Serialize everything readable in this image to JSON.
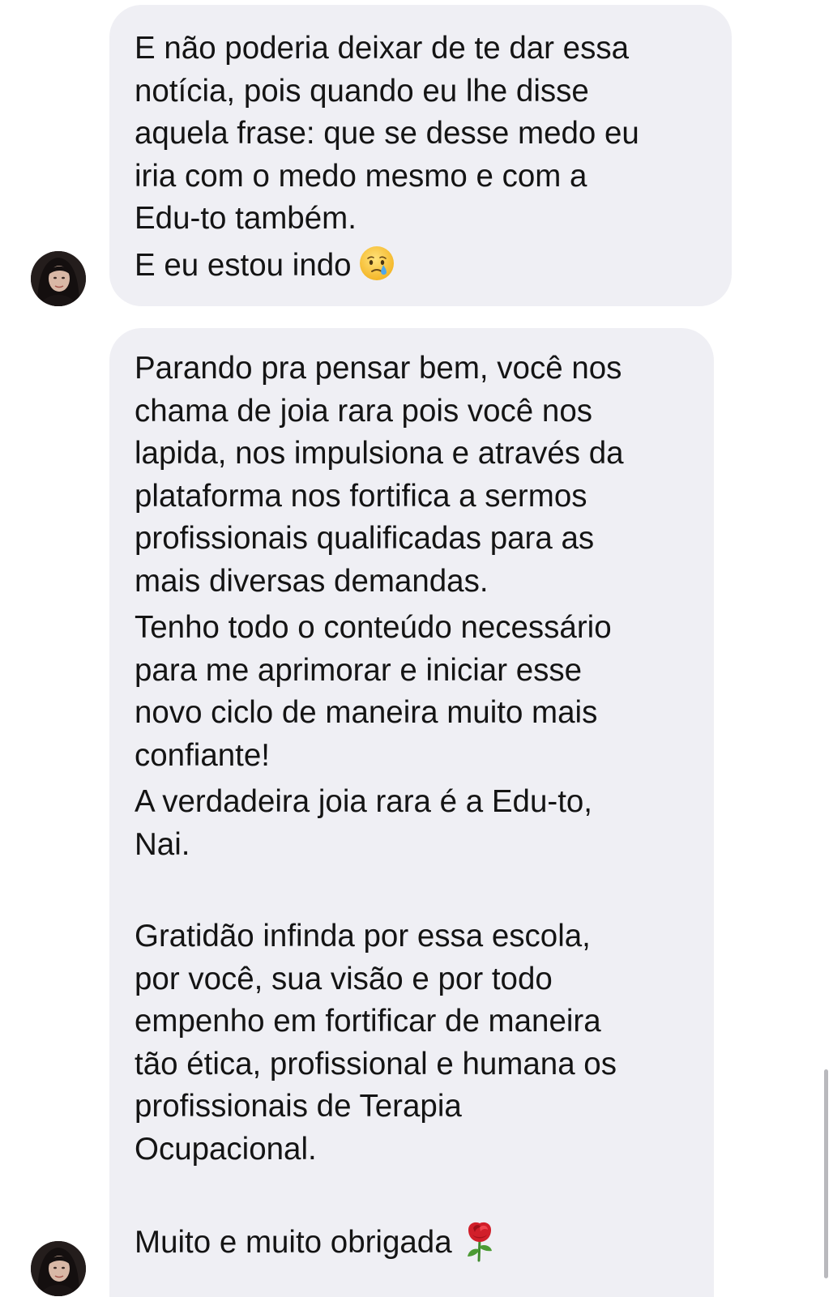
{
  "messages": [
    {
      "lines": [
        "E não poderia deixar de te dar essa",
        "notícia, pois quando eu lhe disse",
        "aquela frase: que se desse medo eu",
        "iria com o medo mesmo e com a",
        "Edu-to também.",
        "E eu estou indo"
      ],
      "trailing_emoji": "crying-face-emoji"
    },
    {
      "paragraph_1": [
        "Parando pra pensar bem, você nos",
        "chama de joia rara pois você nos",
        "lapida, nos impulsiona e através da",
        "plataforma nos fortifica a sermos",
        "profissionais qualificadas para as",
        "mais diversas demandas."
      ],
      "paragraph_2": [
        "Tenho todo o conteúdo necessário",
        "para me aprimorar e iniciar esse",
        "novo ciclo de maneira muito mais",
        "confiante!"
      ],
      "paragraph_3": [
        "A verdadeira joia rara é a Edu-to,",
        "Nai."
      ],
      "paragraph_4": [
        "Gratidão infinda por essa escola,",
        "por você, sua visão e por todo",
        "empenho em fortificar de maneira",
        "tão ética, profissional e humana os",
        "profissionais de Terapia",
        "Ocupacional."
      ],
      "closing": "Muito e muito obrigada",
      "trailing_emoji": "rose-emoji"
    }
  ],
  "colors": {
    "bubble_background": "#efeff4",
    "text": "#141414",
    "page_background": "#ffffff",
    "scrollbar": "#b9b9bd"
  }
}
